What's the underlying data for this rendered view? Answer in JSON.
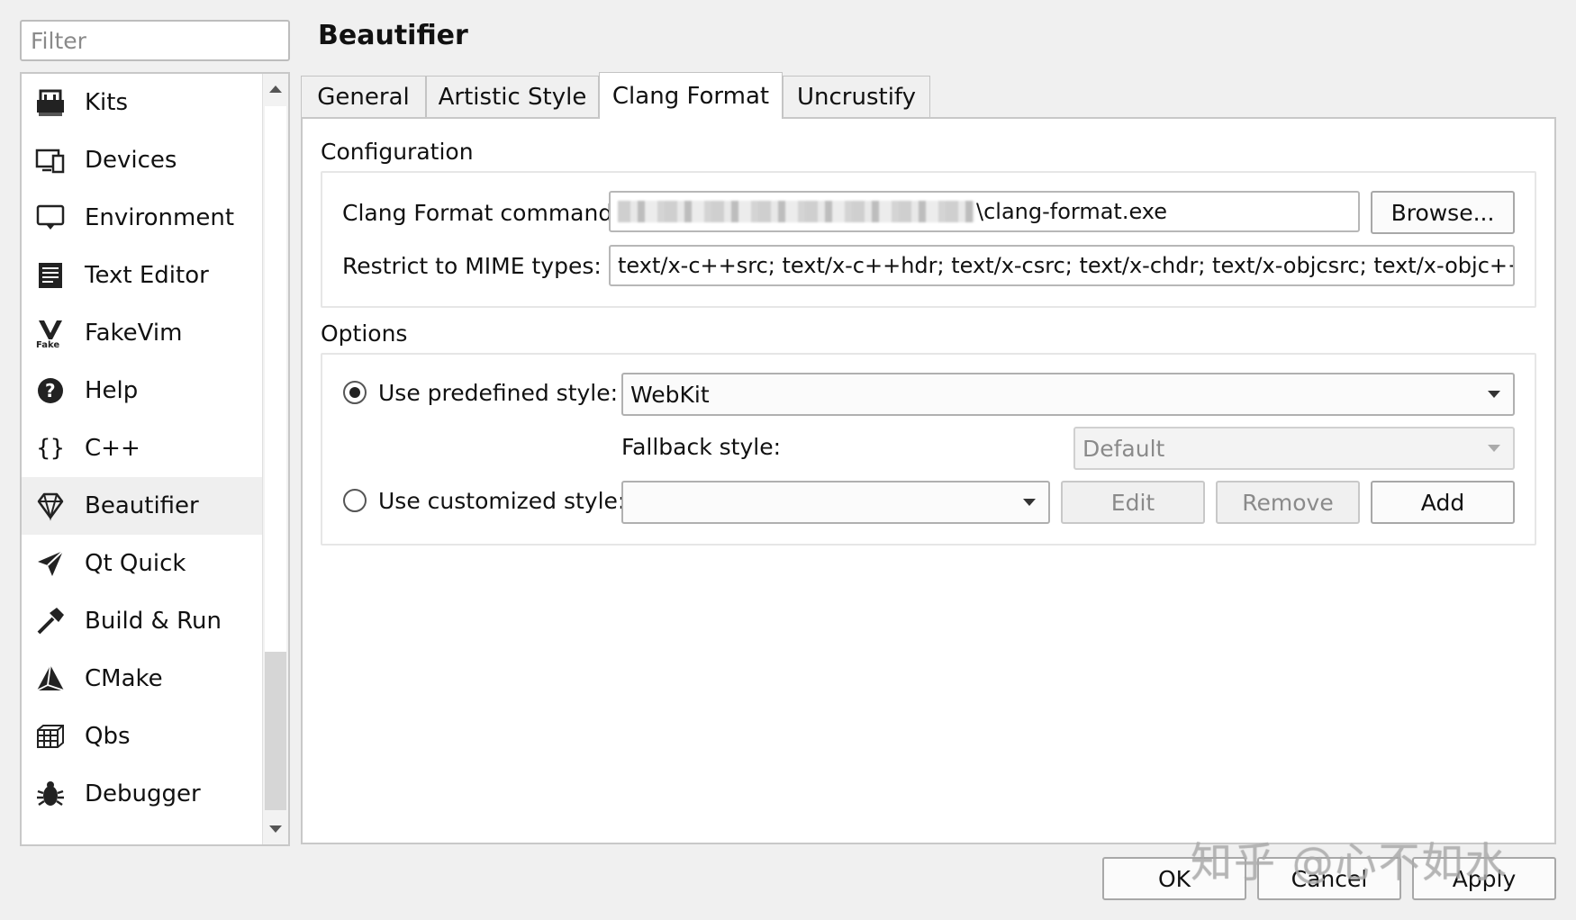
{
  "filter": {
    "placeholder": "Filter"
  },
  "sidebar": {
    "items": [
      {
        "label": "Kits",
        "icon": "kits-icon"
      },
      {
        "label": "Devices",
        "icon": "devices-icon"
      },
      {
        "label": "Environment",
        "icon": "environment-icon"
      },
      {
        "label": "Text Editor",
        "icon": "text-editor-icon"
      },
      {
        "label": "FakeVim",
        "icon": "fakevim-icon"
      },
      {
        "label": "Help",
        "icon": "help-icon"
      },
      {
        "label": "C++",
        "icon": "cpp-braces-icon"
      },
      {
        "label": "Beautifier",
        "icon": "diamond-icon",
        "selected": true
      },
      {
        "label": "Qt Quick",
        "icon": "paper-plane-icon"
      },
      {
        "label": "Build & Run",
        "icon": "hammer-icon"
      },
      {
        "label": "CMake",
        "icon": "cmake-icon"
      },
      {
        "label": "Qbs",
        "icon": "qbs-icon"
      },
      {
        "label": "Debugger",
        "icon": "bug-icon"
      }
    ]
  },
  "header": {
    "title": "Beautifier"
  },
  "tabs": [
    {
      "label": "General"
    },
    {
      "label": "Artistic Style"
    },
    {
      "label": "Clang Format",
      "active": true
    },
    {
      "label": "Uncrustify"
    }
  ],
  "configuration": {
    "section_label": "Configuration",
    "command_label": "Clang Format command:",
    "command_value_suffix": "\\clang-format.exe",
    "browse_label": "Browse...",
    "mime_label": "Restrict to MIME types:",
    "mime_value": "text/x-c++src; text/x-c++hdr; text/x-csrc; text/x-chdr; text/x-objcsrc; text/x-objc++src"
  },
  "options": {
    "section_label": "Options",
    "predefined_label": "Use predefined style:",
    "predefined_value": "WebKit",
    "fallback_label": "Fallback style:",
    "fallback_value": "Default",
    "customized_label": "Use customized style:",
    "customized_value": "",
    "edit_label": "Edit",
    "remove_label": "Remove",
    "add_label": "Add"
  },
  "footer": {
    "ok_label": "OK",
    "cancel_label": "Cancel",
    "apply_label": "Apply"
  }
}
